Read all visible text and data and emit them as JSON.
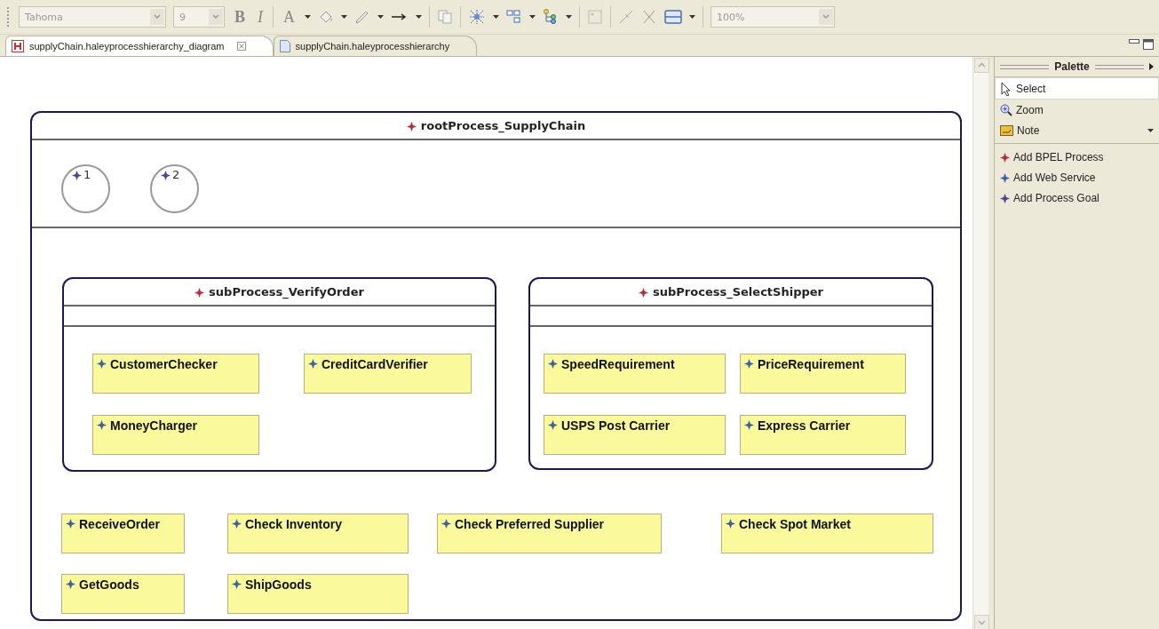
{
  "toolbar": {
    "font": "Tahoma",
    "size": "9",
    "bold": "B",
    "italic": "I",
    "font_color": "A",
    "zoom": "100%"
  },
  "tabs": [
    {
      "label": "supplyChain.haleyprocesshierarchy_diagram",
      "kind": "diagram",
      "selected": true
    },
    {
      "label": "supplyChain.haleyprocesshierarchy",
      "kind": "file",
      "selected": false
    }
  ],
  "diagram": {
    "root": {
      "title": "rootProcess_SupplyChain",
      "goals": [
        {
          "label": "1"
        },
        {
          "label": "2"
        }
      ],
      "subprocesses": [
        {
          "title": "subProcess_VerifyOrder",
          "tasks": [
            {
              "label": "CustomerChecker"
            },
            {
              "label": "CreditCardVerifier"
            },
            {
              "label": "MoneyCharger"
            }
          ]
        },
        {
          "title": "subProcess_SelectShipper",
          "tasks": [
            {
              "label": "SpeedRequirement"
            },
            {
              "label": "PriceRequirement"
            },
            {
              "label": "USPS Post Carrier"
            },
            {
              "label": "Express Carrier"
            }
          ]
        }
      ],
      "tasks": [
        {
          "label": "ReceiveOrder"
        },
        {
          "label": "Check Inventory"
        },
        {
          "label": "Check Preferred Supplier"
        },
        {
          "label": "Check Spot Market"
        },
        {
          "label": "GetGoods"
        },
        {
          "label": "ShipGoods"
        }
      ]
    }
  },
  "palette": {
    "title": "Palette",
    "items": [
      {
        "label": "Select",
        "kind": "select",
        "selected": true
      },
      {
        "label": "Zoom",
        "kind": "zoom",
        "selected": false
      },
      {
        "label": "Note",
        "kind": "note",
        "selected": false
      },
      {
        "label": "Add BPEL Process",
        "kind": "process",
        "selected": false
      },
      {
        "label": "Add Web Service",
        "kind": "service",
        "selected": false
      },
      {
        "label": "Add Process Goal",
        "kind": "goal",
        "selected": false
      }
    ]
  }
}
